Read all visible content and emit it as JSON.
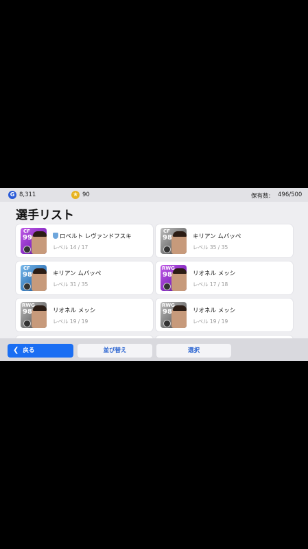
{
  "topbar": {
    "gp_icon": "G",
    "gp_value": "8,311",
    "coin_icon": "★",
    "coin_value": "90",
    "owned_label": "保有数:",
    "owned_value": "496/500"
  },
  "page": {
    "title": "選手リスト"
  },
  "players": [
    {
      "position": "CF",
      "rating": "99",
      "name": "ロベルト レヴァンドフスキ",
      "level": "レベル 14 / 17",
      "card_color": "purple",
      "favorite": true
    },
    {
      "position": "CF",
      "rating": "98",
      "name": "キリアン ムバッペ",
      "level": "レベル 35 / 35",
      "card_color": "gray",
      "favorite": false
    },
    {
      "position": "CF",
      "rating": "98",
      "name": "キリアン ムバッペ",
      "level": "レベル 31 / 35",
      "card_color": "blue",
      "favorite": false
    },
    {
      "position": "RWG",
      "rating": "98",
      "name": "リオネル メッシ",
      "level": "レベル 17 / 18",
      "card_color": "purple",
      "favorite": false
    },
    {
      "position": "RWG",
      "rating": "98",
      "name": "リオネル メッシ",
      "level": "レベル 19 / 19",
      "card_color": "gray",
      "favorite": false
    },
    {
      "position": "RWG",
      "rating": "98",
      "name": "リオネル メッシ",
      "level": "レベル 19 / 19",
      "card_color": "gray",
      "favorite": false
    },
    {
      "position": "",
      "rating": "",
      "name": "",
      "level": "",
      "card_color": "purple",
      "favorite": false
    },
    {
      "position": "",
      "rating": "",
      "name": "",
      "level": "",
      "card_color": "purple",
      "favorite": false
    }
  ],
  "buttons": {
    "back_label": "戻る",
    "back_icon": "chevron-left-icon",
    "sort_label": "並び替え",
    "select_label": "選択"
  },
  "colors": {
    "accent": "#1a6ef3",
    "button_text": "#2a64d1",
    "background": "#eeeef1"
  }
}
